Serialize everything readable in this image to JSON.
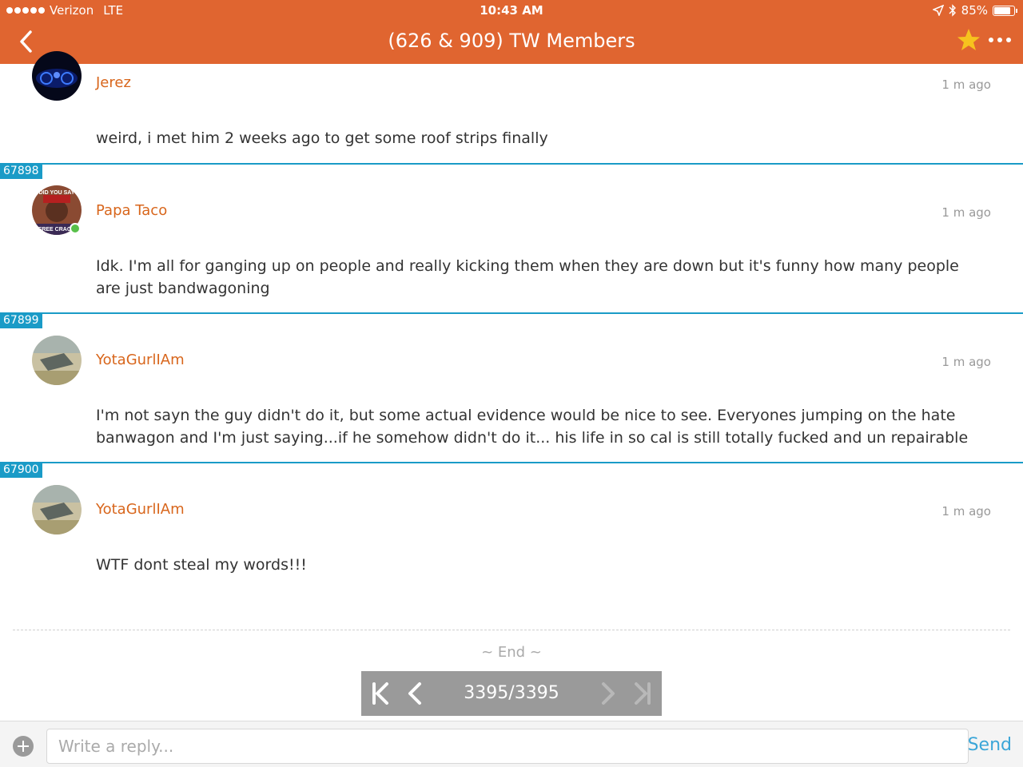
{
  "status": {
    "carrier": "Verizon",
    "network": "LTE",
    "time": "10:43 AM",
    "battery": "85%",
    "battery_level": 0.85
  },
  "nav": {
    "title": "(626 & 909) TW Members"
  },
  "posts": [
    {
      "id": "",
      "user": "Jerez",
      "time": "1 m ago",
      "text": "weird, i met him 2 weeks ago to get some roof strips finally"
    },
    {
      "id": "67898",
      "user": "Papa Taco",
      "time": "1 m ago",
      "text": "Idk.  I'm all for ganging up on people and really kicking them when they are down but it's funny how many people are just bandwagoning",
      "avatar_text_top": "DID YOU SAY",
      "avatar_text_bottom": "FREE CRACK"
    },
    {
      "id": "67899",
      "user": "YotaGurlIAm",
      "time": "1 m ago",
      "text": "I'm not sayn the guy didn't do it, but some actual evidence would be nice to see. Everyones jumping on the hate banwagon and I'm just saying...if he somehow didn't do it... his life in so cal is still totally fucked and un repairable"
    },
    {
      "id": "67900",
      "user": "YotaGurlIAm",
      "time": "1 m ago",
      "text": "WTF dont steal my words!!!"
    }
  ],
  "end_label": "~ End ~",
  "pager": {
    "count": "3395/3395"
  },
  "reply": {
    "placeholder": "Write a reply...",
    "send_label": "Send"
  },
  "colors": {
    "header": "#e06530",
    "username": "#d8661c",
    "post_id": "#1a9bc7",
    "send": "#3ba6d8"
  }
}
